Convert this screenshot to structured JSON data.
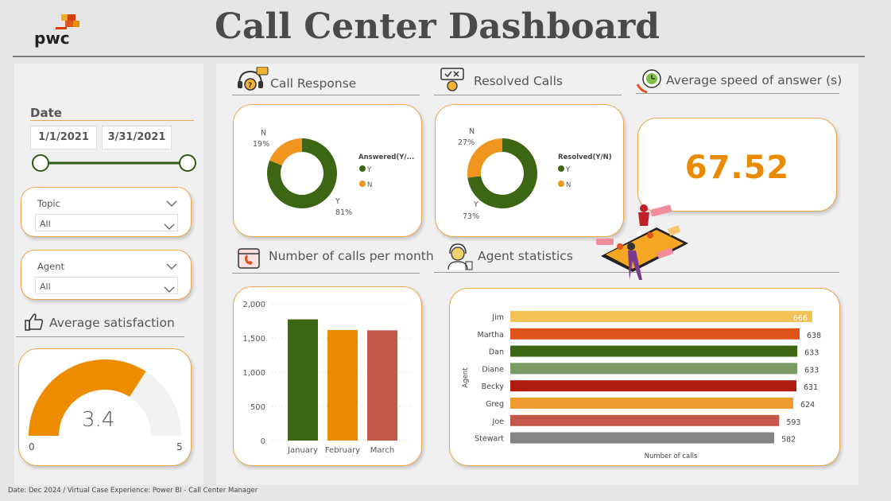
{
  "header": {
    "title": "Call Center Dashboard",
    "logo_text": "pwc"
  },
  "filters": {
    "date_label": "Date",
    "start_date": "1/1/2021",
    "end_date": "3/31/2021",
    "topic": {
      "label": "Topic",
      "value": "All"
    },
    "agent": {
      "label": "Agent",
      "value": "All"
    }
  },
  "satisfaction": {
    "title": "Average satisfaction",
    "value": 3.4,
    "value_label": "3.4",
    "min_label": "0",
    "max_label": "5",
    "min": 0,
    "max": 5
  },
  "call_response": {
    "title": "Call Response",
    "legend_title": "Answered(Y/...",
    "slices": [
      {
        "label": "Y",
        "pct": 81,
        "pct_label": "81%",
        "color": "#3d6614"
      },
      {
        "label": "N",
        "pct": 19,
        "pct_label": "19%",
        "color": "#f0951e"
      }
    ]
  },
  "resolved_calls": {
    "title": "Resolved Calls",
    "legend_title": "Resolved(Y/N)",
    "slices": [
      {
        "label": "Y",
        "pct": 73,
        "pct_label": "73%",
        "color": "#3d6614"
      },
      {
        "label": "N",
        "pct": 27,
        "pct_label": "27%",
        "color": "#f0951e"
      }
    ]
  },
  "speed": {
    "title": "Average speed of answer (s)",
    "value": "67.52"
  },
  "monthly_chart": {
    "title": "Number of calls per month",
    "chart_data": {
      "type": "bar",
      "categories": [
        "January",
        "February",
        "March"
      ],
      "values": [
        1772,
        1616,
        1612
      ],
      "colors": [
        "#3d6614",
        "#ea8a00",
        "#c4574a"
      ],
      "ylim": [
        0,
        2000
      ],
      "yticks": [
        0,
        500,
        1000,
        1500,
        2000
      ],
      "ytick_labels": [
        "0",
        "500",
        "1,000",
        "1,500",
        "2,000"
      ],
      "grid": true
    }
  },
  "agent_chart": {
    "title": "Agent statistics",
    "chart_data": {
      "type": "bar",
      "orientation": "horizontal",
      "categories": [
        "Jim",
        "Martha",
        "Dan",
        "Diane",
        "Becky",
        "Greg",
        "Joe",
        "Stewart"
      ],
      "values": [
        666,
        638,
        633,
        633,
        631,
        624,
        593,
        582
      ],
      "value_labels": [
        "666",
        "638",
        "633",
        "633",
        "631",
        "624",
        "593",
        "582"
      ],
      "colors": [
        "#f2c257",
        "#e0541c",
        "#3d6614",
        "#7a9a64",
        "#b01c0e",
        "#f09a30",
        "#c4574a",
        "#858585"
      ],
      "xlabel": "Number of calls",
      "ylabel": "Agent",
      "xlim": [
        0,
        666
      ]
    }
  },
  "footer": {
    "text": "Date: Dec 2024 / Virtual Case Experience: Power BI  - Call Center Manager"
  },
  "icons": {
    "call_response": "headset-question-icon",
    "resolved": "resolved-check-icon",
    "speed": "stopwatch-phone-icon",
    "monthly": "calendar-phone-icon",
    "agent": "agent-headset-icon",
    "satisfaction": "thumbs-up-icon",
    "illustration": "phone-notifications-illustration"
  }
}
